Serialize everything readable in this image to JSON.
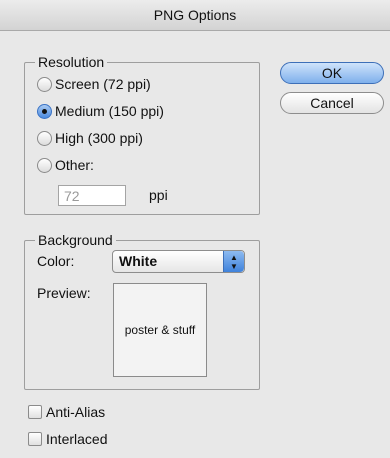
{
  "window": {
    "title": "PNG Options"
  },
  "resolution": {
    "legend": "Resolution",
    "options": [
      "Screen (72 ppi)",
      "Medium (150 ppi)",
      "High (300 ppi)",
      "Other:"
    ],
    "selected": "Medium (150 ppi)",
    "other_value": "72",
    "unit": "ppi"
  },
  "buttons": {
    "ok": "OK",
    "cancel": "Cancel"
  },
  "background": {
    "legend": "Background",
    "color_label": "Color:",
    "color_value": "White",
    "preview_label": "Preview:",
    "preview_text": "poster & stuff"
  },
  "options": {
    "anti_alias": {
      "label": "Anti-Alias",
      "checked": false
    },
    "interlaced": {
      "label": "Interlaced",
      "checked": false
    }
  }
}
